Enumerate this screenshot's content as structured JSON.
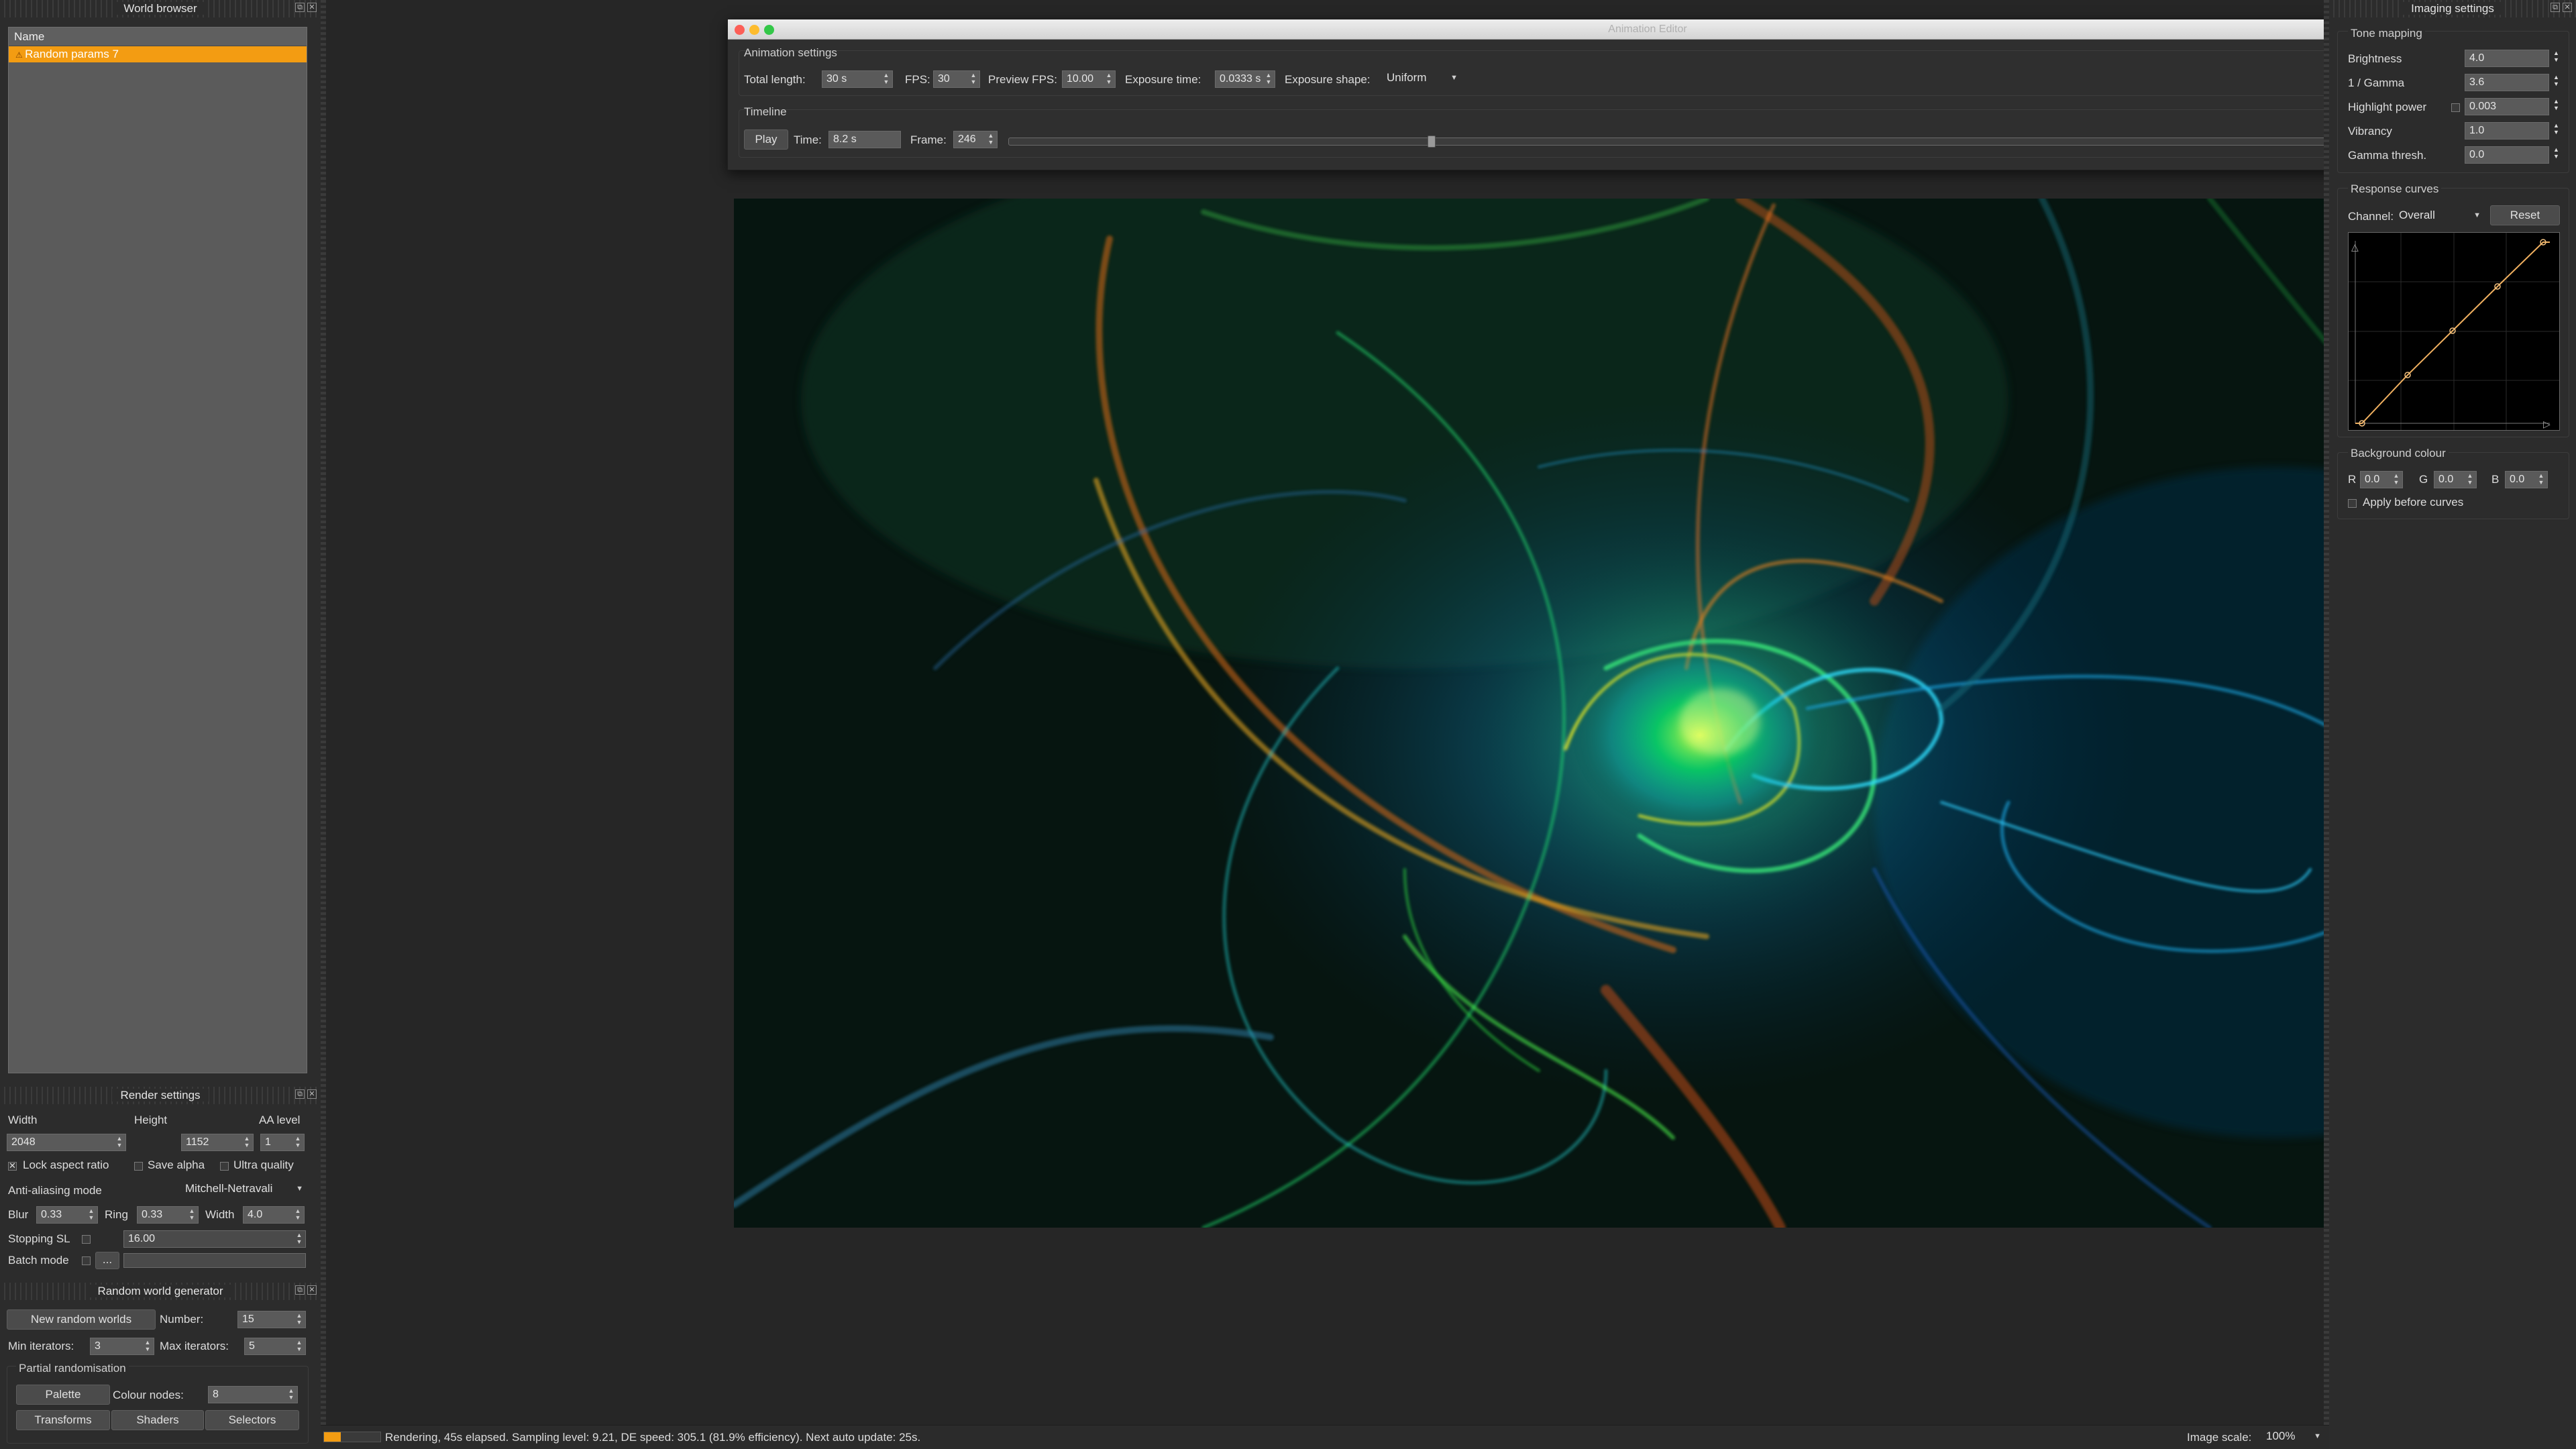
{
  "world_browser": {
    "title": "World browser",
    "header": "Name",
    "items": [
      "Random params 7"
    ]
  },
  "render_settings": {
    "title": "Render settings",
    "width_label": "Width",
    "height_label": "Height",
    "aa_label": "AA level",
    "width": "2048",
    "height": "1152",
    "aa": "1",
    "lock_aspect": "Lock aspect ratio",
    "save_alpha": "Save alpha",
    "ultra": "Ultra quality",
    "aa_mode_label": "Anti-aliasing mode",
    "aa_mode": "Mitchell-Netravali",
    "blur_label": "Blur",
    "blur": "0.33",
    "ring_label": "Ring",
    "ring": "0.33",
    "fw_label": "Width",
    "fw": "4.0",
    "stopping_label": "Stopping SL",
    "stopping": "16.00",
    "batch_label": "Batch mode",
    "batch_btn": "..."
  },
  "random_gen": {
    "title": "Random world generator",
    "new_btn": "New random worlds",
    "number_label": "Number:",
    "number": "15",
    "min_label": "Min iterators:",
    "min": "3",
    "max_label": "Max iterators:",
    "max": "5",
    "partial_label": "Partial randomisation",
    "palette_btn": "Palette",
    "colour_nodes_label": "Colour nodes:",
    "colour_nodes": "8",
    "transforms_btn": "Transforms",
    "shaders_btn": "Shaders",
    "selectors_btn": "Selectors"
  },
  "anim_editor": {
    "title": "Animation Editor",
    "settings_label": "Animation settings",
    "total_length_label": "Total length:",
    "total_length": "30 s",
    "fps_label": "FPS:",
    "fps": "30",
    "preview_fps_label": "Preview FPS:",
    "preview_fps": "10.00",
    "exposure_time_label": "Exposure time:",
    "exposure_time": "0.0333 s",
    "exposure_shape_label": "Exposure shape:",
    "exposure_shape": "Uniform",
    "timeline_label": "Timeline",
    "play_btn": "Play",
    "time_label": "Time:",
    "time": "8.2 s",
    "frame_label": "Frame:",
    "frame": "246",
    "timeline_position": 0.273
  },
  "imaging": {
    "title": "Imaging settings",
    "tone_label": "Tone mapping",
    "brightness_label": "Brightness",
    "brightness": "4.0",
    "gamma_label": "1 / Gamma",
    "gamma": "3.6",
    "highlight_label": "Highlight power",
    "highlight": "0.003",
    "vibrancy_label": "Vibrancy",
    "vibrancy": "1.0",
    "gthresh_label": "Gamma thresh.",
    "gthresh": "0.0",
    "curves_label": "Response curves",
    "channel_label": "Channel:",
    "channel": "Overall",
    "reset_btn": "Reset",
    "bg_label": "Background colour",
    "r_label": "R",
    "r": "0.0",
    "g_label": "G",
    "g": "0.0",
    "b_label": "B",
    "b": "0.0",
    "apply_label": "Apply before curves"
  },
  "status": {
    "text": "Rendering, 45s elapsed. Sampling level: 9.21, DE speed: 305.1 (81.9% efficiency). Next auto update: 25s.",
    "scale_label": "Image scale:",
    "scale": "100%"
  },
  "colors": {
    "accent": "#f39c12"
  }
}
